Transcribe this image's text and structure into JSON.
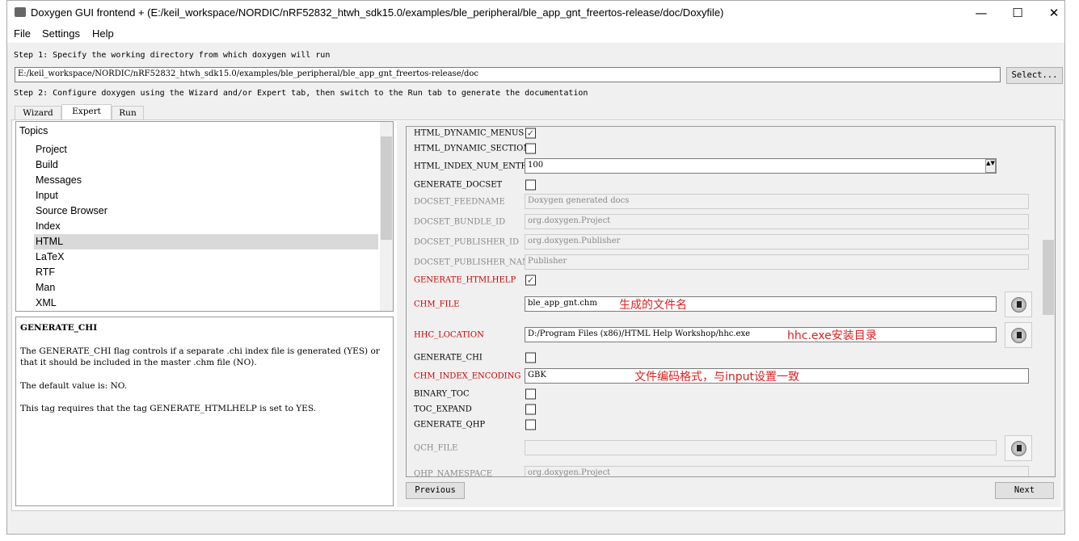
{
  "window": {
    "title": "Doxygen GUI frontend + (E:/keil_workspace/NORDIC/nRF52832_htwh_sdk15.0/examples/ble_peripheral/ble_app_gnt_freertos-release/doc/Doxyfile)",
    "minimize": "—",
    "maximize": "☐",
    "close": "✕"
  },
  "menu": [
    "File",
    "Settings",
    "Help"
  ],
  "step1": {
    "label": "Step 1: Specify the working directory from which doxygen will run",
    "path": "E:/keil_workspace/NORDIC/nRF52832_htwh_sdk15.0/examples/ble_peripheral/ble_app_gnt_freertos-release/doc",
    "select": "Select..."
  },
  "step2": {
    "label": "Step 2: Configure doxygen using the Wizard and/or Expert tab, then switch to the Run tab to generate the documentation"
  },
  "tabs": [
    "Wizard",
    "Expert",
    "Run"
  ],
  "topics": {
    "header": "Topics",
    "items": [
      "Project",
      "Build",
      "Messages",
      "Input",
      "Source Browser",
      "Index",
      "HTML",
      "LaTeX",
      "RTF",
      "Man",
      "XML"
    ],
    "selected": "HTML"
  },
  "description": {
    "title": "GENERATE_CHI",
    "p1": "The GENERATE_CHI flag controls if a separate .chi index file is generated (YES) or that it should be included in the master .chm file (NO).",
    "p2": "The default value is: NO.",
    "p3": "This tag requires that the tag GENERATE_HTMLHELP is set to YES."
  },
  "options": [
    {
      "name": "HTML_DYNAMIC_MENUS",
      "type": "check",
      "checked": true
    },
    {
      "name": "HTML_DYNAMIC_SECTIONS",
      "type": "check",
      "checked": false
    },
    {
      "name": "HTML_INDEX_NUM_ENTRIES",
      "type": "spin",
      "value": "100"
    },
    {
      "name": "GENERATE_DOCSET",
      "type": "check",
      "checked": false
    },
    {
      "name": "DOCSET_FEEDNAME",
      "type": "text",
      "value": "Doxygen generated docs",
      "disabled": true
    },
    {
      "name": "DOCSET_BUNDLE_ID",
      "type": "text",
      "value": "org.doxygen.Project",
      "disabled": true
    },
    {
      "name": "DOCSET_PUBLISHER_ID",
      "type": "text",
      "value": "org.doxygen.Publisher",
      "disabled": true
    },
    {
      "name": "DOCSET_PUBLISHER_NAME",
      "type": "text",
      "value": "Publisher",
      "disabled": true
    },
    {
      "name": "GENERATE_HTMLHELP",
      "type": "check",
      "checked": true,
      "changed": true
    },
    {
      "name": "CHM_FILE",
      "type": "file",
      "value": "ble_app_gnt.chm",
      "changed": true,
      "note": "生成的文件名"
    },
    {
      "name": "HHC_LOCATION",
      "type": "file",
      "value": "D:/Program Files (x86)/HTML Help Workshop/hhc.exe",
      "changed": true,
      "note": "hhc.exe安装目录"
    },
    {
      "name": "GENERATE_CHI",
      "type": "check",
      "checked": false
    },
    {
      "name": "CHM_INDEX_ENCODING",
      "type": "text",
      "value": "GBK",
      "changed": true,
      "note": "文件编码格式，与input设置一致"
    },
    {
      "name": "BINARY_TOC",
      "type": "check",
      "checked": false
    },
    {
      "name": "TOC_EXPAND",
      "type": "check",
      "checked": false
    },
    {
      "name": "GENERATE_QHP",
      "type": "check",
      "checked": false
    },
    {
      "name": "QCH_FILE",
      "type": "file",
      "value": "",
      "disabled": true
    },
    {
      "name": "QHP_NAMESPACE",
      "type": "text",
      "value": "org.doxygen.Project",
      "disabled": true
    }
  ],
  "nav": {
    "previous": "Previous",
    "next": "Next"
  }
}
